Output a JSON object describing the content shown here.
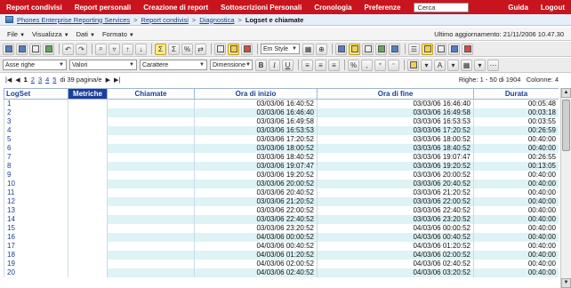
{
  "topnav": {
    "items": [
      "Report condivisi",
      "Report personali",
      "Creazione di report",
      "Sottoscrizioni Personali",
      "Cronologia",
      "Preferenze"
    ],
    "search_placeholder": "Cerca",
    "right_items": [
      "Guida",
      "Logout"
    ],
    "bg_color": "#c8141e"
  },
  "breadcrumb": {
    "items": [
      "Phones Enterprise Reporting Services",
      "Report condivisi",
      "Diagnostica"
    ],
    "separator": ">",
    "current": "Logset e chiamate"
  },
  "menubar": {
    "menus": [
      "File",
      "Visualizza",
      "Dati",
      "Formato"
    ],
    "updated": "Ultimo aggiornamento: 21/11/2006 10.47.30"
  },
  "toolbar2": {
    "selects": [
      "Asse righe",
      "Valori",
      "Carattere",
      "Dimensione"
    ],
    "style_select": "Em Style"
  },
  "pager": {
    "pages": [
      "1",
      "2",
      "3",
      "4",
      "5"
    ],
    "of_pages": "di 39 pagina/e",
    "rows_info": "Righe: 1 - 50 di 1904",
    "cols_info": "Colonne: 4"
  },
  "grid": {
    "headers": {
      "logset": "LogSet",
      "metriche": "Metriche",
      "chiamate": "Chiamate",
      "inizio": "Ora di inizio",
      "fine": "Ora di fine",
      "durata": "Durata"
    },
    "rows": [
      {
        "id": "1",
        "start": "03/03/06 16:40:52",
        "end": "03/03/06 16:46:40",
        "dur": "00:05:48"
      },
      {
        "id": "2",
        "start": "03/03/06 16:46:40",
        "end": "03/03/06 16:49:58",
        "dur": "00:03:18"
      },
      {
        "id": "3",
        "start": "03/03/06 16:49:58",
        "end": "03/03/06 16:53:53",
        "dur": "00:03:55"
      },
      {
        "id": "4",
        "start": "03/03/06 16:53:53",
        "end": "03/03/06 17:20:52",
        "dur": "00:26:59"
      },
      {
        "id": "5",
        "start": "03/03/06 17:20:52",
        "end": "03/03/06 18:00:52",
        "dur": "00:40:00"
      },
      {
        "id": "6",
        "start": "03/03/06 18:00:52",
        "end": "03/03/06 18:40:52",
        "dur": "00:40:00"
      },
      {
        "id": "7",
        "start": "03/03/06 18:40:52",
        "end": "03/03/06 19:07:47",
        "dur": "00:26:55"
      },
      {
        "id": "8",
        "start": "03/03/06 19:07:47",
        "end": "03/03/06 19:20:52",
        "dur": "00:13:05"
      },
      {
        "id": "9",
        "start": "03/03/06 19:20:52",
        "end": "03/03/06 20:00:52",
        "dur": "00:40:00"
      },
      {
        "id": "10",
        "start": "03/03/06 20:00:52",
        "end": "03/03/06 20:40:52",
        "dur": "00:40:00"
      },
      {
        "id": "11",
        "start": "03/03/06 20:40:52",
        "end": "03/03/06 21:20:52",
        "dur": "00:40:00"
      },
      {
        "id": "12",
        "start": "03/03/06 21:20:52",
        "end": "03/03/06 22:00:52",
        "dur": "00:40:00"
      },
      {
        "id": "13",
        "start": "03/03/06 22:00:52",
        "end": "03/03/06 22:40:52",
        "dur": "00:40:00"
      },
      {
        "id": "14",
        "start": "03/03/06 22:40:52",
        "end": "03/03/06 23:20:52",
        "dur": "00:40:00"
      },
      {
        "id": "15",
        "start": "03/03/06 23:20:52",
        "end": "04/03/06 00:00:52",
        "dur": "00:40:00"
      },
      {
        "id": "16",
        "start": "04/03/06 00:00:52",
        "end": "04/03/06 00:40:52",
        "dur": "00:40:00"
      },
      {
        "id": "17",
        "start": "04/03/06 00:40:52",
        "end": "04/03/06 01:20:52",
        "dur": "00:40:00"
      },
      {
        "id": "18",
        "start": "04/03/06 01:20:52",
        "end": "04/03/06 02:00:52",
        "dur": "00:40:00"
      },
      {
        "id": "19",
        "start": "04/03/06 02:00:52",
        "end": "04/03/06 02:40:52",
        "dur": "00:40:00"
      },
      {
        "id": "20",
        "start": "04/03/06 02:40:52",
        "end": "04/03/06 03:20:52",
        "dur": "00:40:00"
      }
    ]
  }
}
